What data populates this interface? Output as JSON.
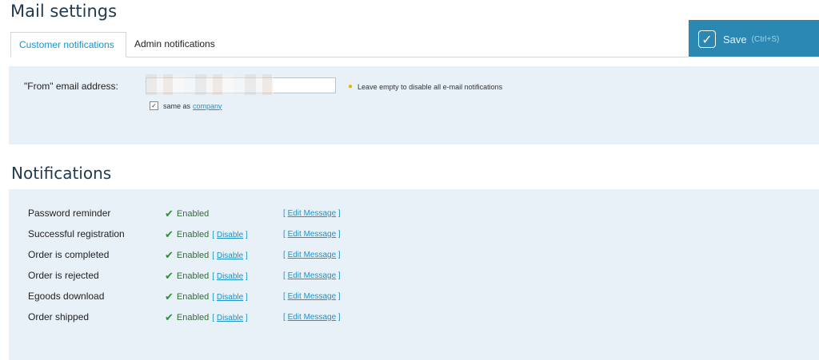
{
  "page_title": "Mail settings",
  "tabs": [
    {
      "label": "Customer notifications",
      "active": true
    },
    {
      "label": "Admin notifications",
      "active": false
    }
  ],
  "save": {
    "label": "Save",
    "shortcut": "(Ctrl+S)"
  },
  "from_section": {
    "label": "\"From\" email address:",
    "input_value": "",
    "hint": "Leave empty to disable all e-mail notifications",
    "same_as_prefix": "same as",
    "same_as_link": "company",
    "same_as_checked": true
  },
  "notifications_title": "Notifications",
  "notifications": [
    {
      "name": "Password reminder",
      "status": "Enabled",
      "disable": null,
      "edit": "Edit Message"
    },
    {
      "name": "Successful registration",
      "status": "Enabled",
      "disable": "Disable",
      "edit": "Edit Message"
    },
    {
      "name": "Order is completed",
      "status": "Enabled",
      "disable": "Disable",
      "edit": "Edit Message"
    },
    {
      "name": "Order is rejected",
      "status": "Enabled",
      "disable": "Disable",
      "edit": "Edit Message"
    },
    {
      "name": "Egoods download",
      "status": "Enabled",
      "disable": "Disable",
      "edit": "Edit Message"
    },
    {
      "name": "Order shipped",
      "status": "Enabled",
      "disable": "Disable",
      "edit": "Edit Message"
    }
  ],
  "colors": {
    "accent": "#1a93c8",
    "save_bg": "#2a88b2",
    "panel_bg": "#e9f1f8",
    "enabled": "#2e8b3a"
  },
  "icons": {
    "save": "check-icon",
    "hint": "lightbulb-icon",
    "status": "checkmark-icon"
  }
}
